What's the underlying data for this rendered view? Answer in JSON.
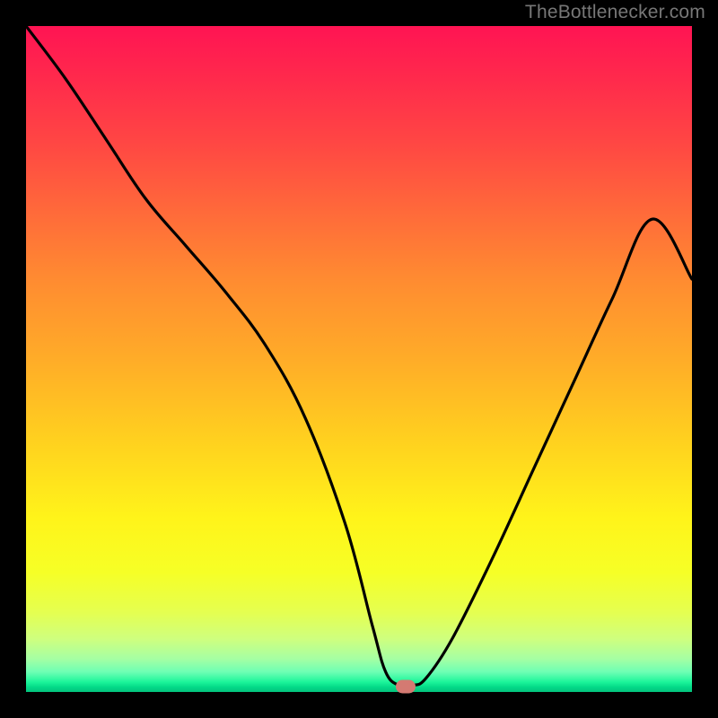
{
  "attribution": "TheBottlenecker.com",
  "colors": {
    "frame": "#000000",
    "curve": "#000000",
    "marker": "#d47a72"
  },
  "chart_data": {
    "type": "line",
    "title": "",
    "xlabel": "",
    "ylabel": "",
    "xlim": [
      0,
      100
    ],
    "ylim": [
      0,
      100
    ],
    "grid": false,
    "series": [
      {
        "name": "bottleneck-curve",
        "x": [
          0,
          6,
          12,
          18,
          24,
          30,
          36,
          42,
          48,
          52,
          54,
          56,
          58,
          60,
          64,
          70,
          76,
          82,
          88,
          94,
          100
        ],
        "values": [
          100,
          92,
          83,
          74,
          67,
          60,
          52,
          41,
          25,
          10,
          3,
          1,
          1,
          2,
          8,
          20,
          33,
          46,
          59,
          71,
          62
        ]
      }
    ],
    "annotations": [
      {
        "name": "min-marker",
        "x": 57,
        "y": 0.8
      }
    ]
  }
}
